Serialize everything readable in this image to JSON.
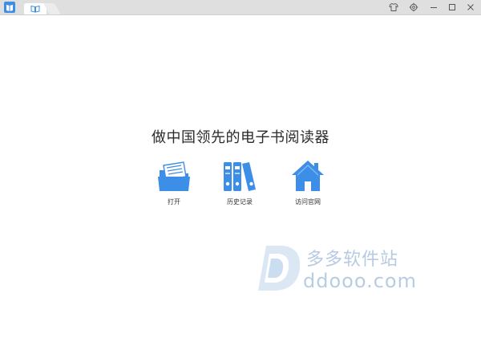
{
  "titlebar": {
    "app_icon": "book-logo-icon",
    "tab_icon": "book-icon",
    "controls": [
      "shirt-icon",
      "gear-icon",
      "minimize-icon",
      "maximize-icon",
      "close-icon"
    ]
  },
  "main": {
    "slogan": "做中国领先的电子书阅读器",
    "actions": [
      {
        "label": "打开",
        "icon": "folder-icon"
      },
      {
        "label": "历史记录",
        "icon": "binders-icon"
      },
      {
        "label": "访问官网",
        "icon": "home-icon"
      }
    ]
  },
  "watermark": {
    "text_cn": "多多软件站",
    "text_en": "ddooo.com"
  },
  "colors": {
    "accent": "#3d8ee6",
    "titlebar": "#dfdfdf",
    "watermark": "#9fb9da"
  }
}
